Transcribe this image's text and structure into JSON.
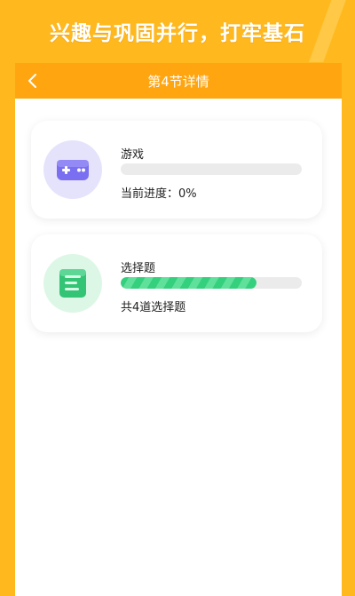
{
  "banner": {
    "text": "兴趣与巩固并行，打牢基石"
  },
  "navbar": {
    "back_icon": "chevron-left-icon",
    "title": "第4节详情"
  },
  "cards": [
    {
      "icon": "gamepad-icon",
      "title": "游戏",
      "progress": 0,
      "subtitle": "当前进度：0%"
    },
    {
      "icon": "document-icon",
      "title": "选择题",
      "progress": 0.75,
      "subtitle": "共4道选择题"
    }
  ],
  "colors": {
    "background": "#FFB91F",
    "navbar": "#FFA510",
    "game_accent": "#7A6FF0",
    "quiz_accent": "#34D07E"
  }
}
